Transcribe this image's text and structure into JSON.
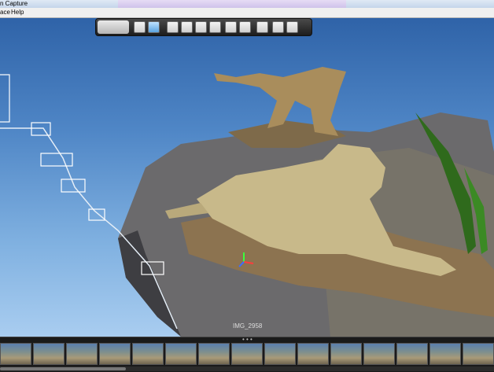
{
  "window": {
    "title": "n Capture"
  },
  "menu": {
    "items": [
      "ace",
      "Help"
    ]
  },
  "toolbar": {
    "mode_icon": "camera-icon",
    "tools": [
      {
        "name": "select-arrow-icon"
      },
      {
        "name": "select-region-icon",
        "active": true
      },
      {
        "name": "paint-select-icon"
      },
      {
        "name": "image-icon"
      },
      {
        "name": "move-camera-icon"
      },
      {
        "name": "camera-view-icon"
      },
      {
        "name": "diamond-icon"
      },
      {
        "name": "youtube-icon"
      },
      {
        "name": "eyedropper-icon"
      },
      {
        "name": "cube-export-icon"
      },
      {
        "name": "page-icon"
      }
    ]
  },
  "viewport": {
    "image_label": "IMG_2958"
  },
  "colors": {
    "sky_top": "#2f63a8",
    "sky_bottom": "#a9cdf0",
    "toolbar": "#2a2a2a",
    "filmstrip": "#1a1a1a"
  }
}
